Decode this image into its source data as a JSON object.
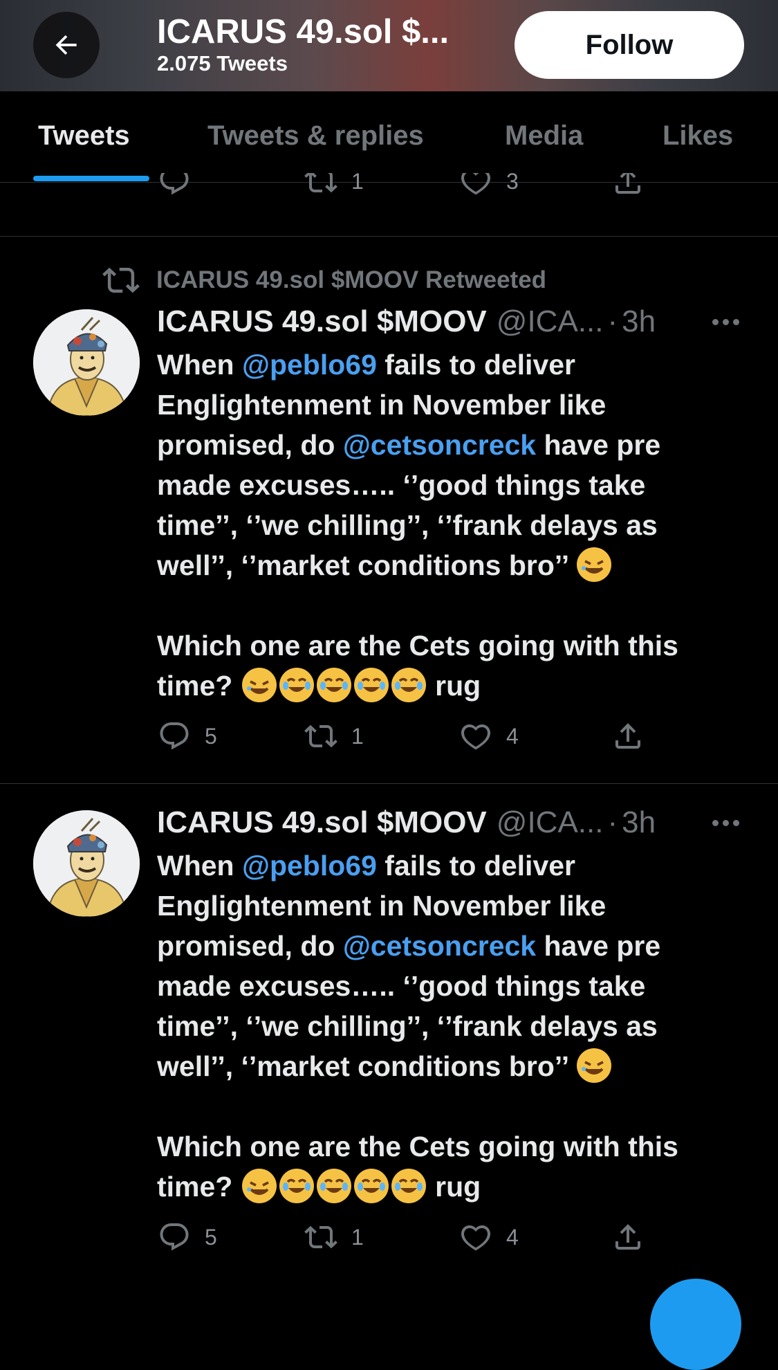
{
  "header": {
    "profile_name": "ICARUS 49.sol $...",
    "tweet_count": "2.075 Tweets",
    "follow_label": "Follow"
  },
  "tabs": [
    {
      "label": "Tweets",
      "active": true
    },
    {
      "label": "Tweets & replies",
      "active": false
    },
    {
      "label": "Media",
      "active": false
    },
    {
      "label": "Likes",
      "active": false
    }
  ],
  "partial_tweet": {
    "retweets": "1",
    "likes": "3"
  },
  "tweets": [
    {
      "retweeted_by": "ICARUS 49.sol $MOOV Retweeted",
      "name": "ICARUS 49.sol $MOOV",
      "handle": "@ICA...",
      "dot": "·",
      "time": "3h",
      "body": {
        "l1a": "When ",
        "l1m": "@peblo69",
        "l1b": " fails to deliver",
        "l2": "Englightenment in November like",
        "l3a": "promised, do ",
        "l3m": "@cetsoncreck",
        "l3b": " have pre",
        "l4": "made excuses….. ‘’good things take",
        "l5": "time’’, ‘’we chilling’’, ‘’frank delays as",
        "l6": "well’’, ‘’market conditions bro’’ ",
        "l7": "Which one are the Cets going with this",
        "l8a": "time? ",
        "l8b": " rug"
      },
      "replies": "5",
      "retweets": "1",
      "likes": "4"
    },
    {
      "name": "ICARUS 49.sol $MOOV",
      "handle": "@ICA...",
      "dot": "·",
      "time": "3h",
      "body": {
        "l1a": "When ",
        "l1m": "@peblo69",
        "l1b": " fails to deliver",
        "l2": "Englightenment in November like",
        "l3a": "promised, do ",
        "l3m": "@cetsoncreck",
        "l3b": " have pre",
        "l4": "made excuses….. ‘’good things take",
        "l5": "time’’, ‘’we chilling’’, ‘’frank delays as",
        "l6": "well’’, ‘’market conditions bro’’ ",
        "l7": "Which one are the Cets going with this",
        "l8a": "time? ",
        "l8b": " rug"
      },
      "replies": "5",
      "retweets": "1",
      "likes": "4"
    }
  ],
  "colors": {
    "accent": "#1d9bf0",
    "mention": "#4a9ff0",
    "muted": "#71767b",
    "background": "#000000"
  }
}
